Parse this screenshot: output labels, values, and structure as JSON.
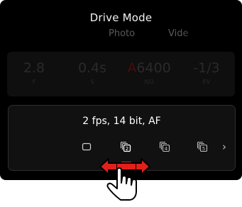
{
  "header": {
    "title": "Drive Mode",
    "tabs": [
      "Photo",
      "Vide"
    ]
  },
  "exposure": [
    {
      "value": "2.8",
      "label": "F"
    },
    {
      "value": "0.4s",
      "label": "S"
    },
    {
      "value_prefix": "A",
      "value": "6400",
      "label": "ISO"
    },
    {
      "value": "-1/3",
      "label": "EV"
    }
  ],
  "drive": {
    "current_setting": "2 fps, 14 bit, AF",
    "modes": [
      "single-frame-icon",
      "continuous-2fps-icon",
      "continuous-4fps-icon",
      "continuous-5fps-icon"
    ],
    "selected_index": 1,
    "more": "›"
  },
  "colors": {
    "screen_bg": "#000000",
    "panel_bg": "#111111",
    "iso_auto_accent": "#4a0c0c",
    "gesture_arrow": "#e0201a"
  }
}
